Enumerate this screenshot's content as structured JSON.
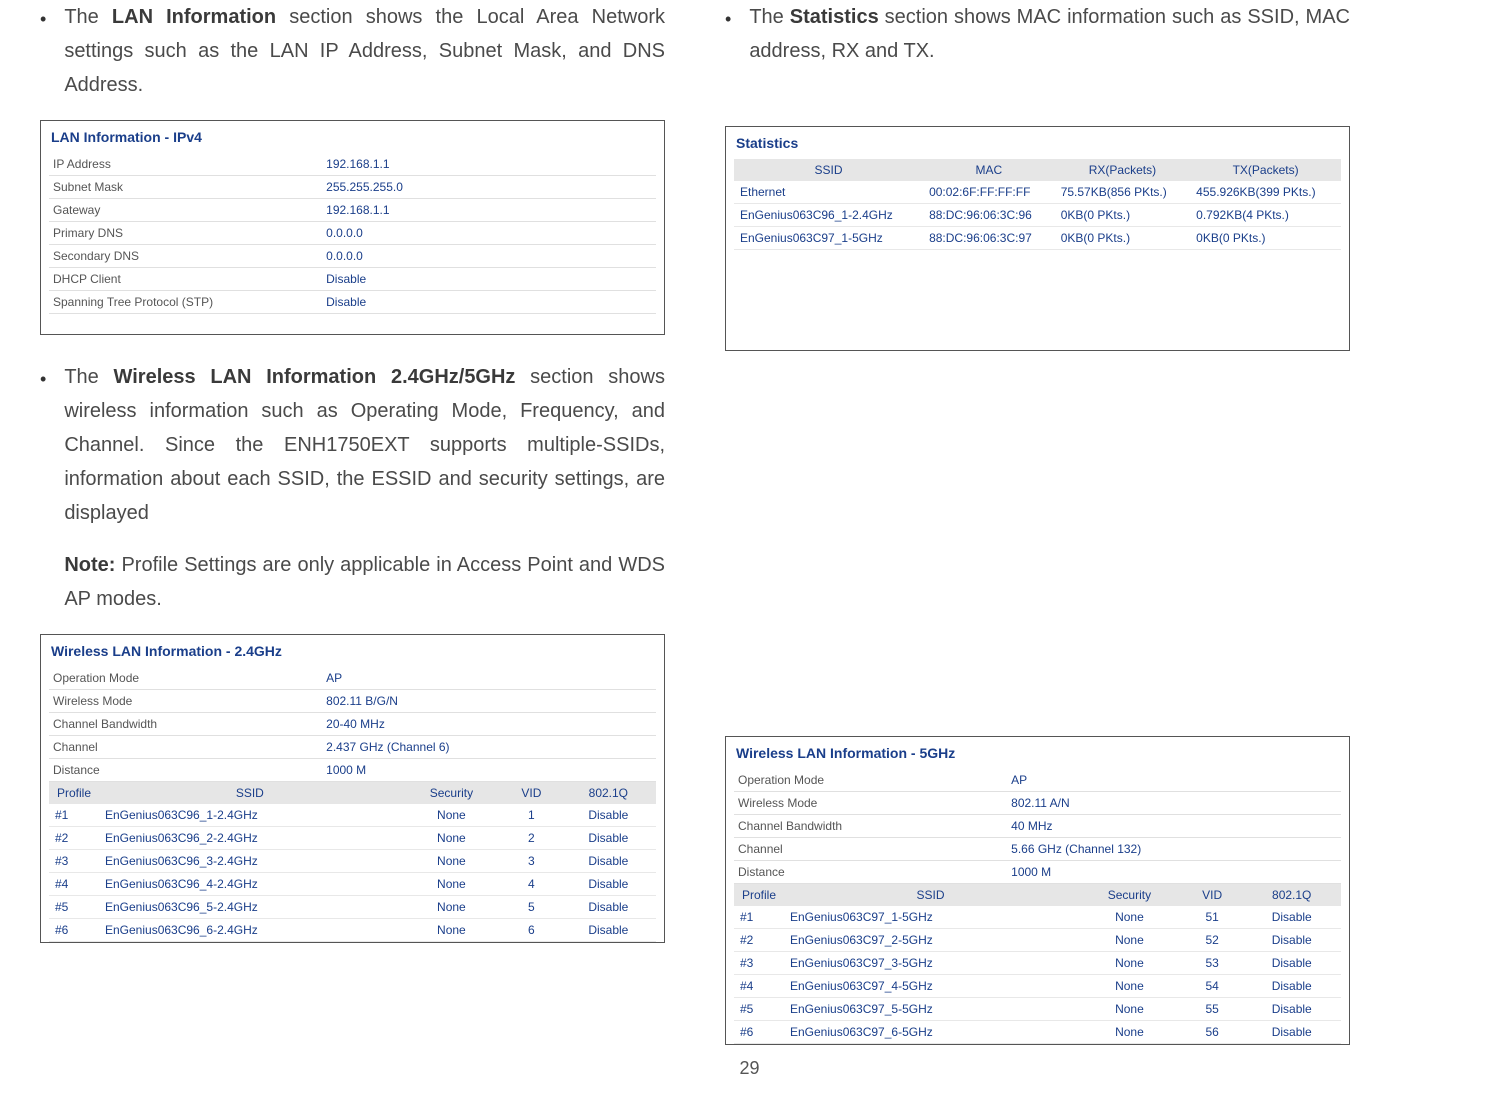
{
  "pageNumber": "29",
  "left": {
    "para1_a": "The ",
    "para1_b": "LAN Information",
    "para1_c": " section shows the Local Area Network settings such as the LAN IP Address, Subnet Mask, and DNS Address.",
    "lanTitle": "LAN Information - IPv4",
    "lan": [
      {
        "k": "IP Address",
        "v": "192.168.1.1"
      },
      {
        "k": "Subnet Mask",
        "v": "255.255.255.0"
      },
      {
        "k": "Gateway",
        "v": "192.168.1.1"
      },
      {
        "k": "Primary DNS",
        "v": "0.0.0.0"
      },
      {
        "k": "Secondary DNS",
        "v": "0.0.0.0"
      },
      {
        "k": "DHCP Client",
        "v": "Disable"
      },
      {
        "k": "Spanning Tree Protocol (STP)",
        "v": "Disable"
      }
    ],
    "para2_a": "The ",
    "para2_b": "Wireless LAN Information 2.4GHz/5GHz",
    "para2_c": " section shows wireless information such as Operating Mode, Frequency, and Channel. Since the ENH1750EXT supports multiple-SSIDs, information about each SSID, the ESSID and security settings, are displayed",
    "note_a": "Note:",
    "note_b": " Profile Settings are only applicable in Access Point and WDS AP modes.",
    "wlan24Title": "Wireless LAN Information - 2.4GHz",
    "wlan24Kv": [
      {
        "k": "Operation Mode",
        "v": "AP"
      },
      {
        "k": "Wireless Mode",
        "v": "802.11 B/G/N"
      },
      {
        "k": "Channel Bandwidth",
        "v": "20-40 MHz"
      },
      {
        "k": "Channel",
        "v": "2.437 GHz (Channel 6)"
      },
      {
        "k": "Distance",
        "v": "1000 M"
      }
    ],
    "profHeaders": {
      "p": "Profile",
      "s": "SSID",
      "sec": "Security",
      "vid": "VID",
      "q": "802.1Q"
    },
    "prof24": [
      {
        "p": "#1",
        "s": "EnGenius063C96_1-2.4GHz",
        "sec": "None",
        "vid": "1",
        "q": "Disable"
      },
      {
        "p": "#2",
        "s": "EnGenius063C96_2-2.4GHz",
        "sec": "None",
        "vid": "2",
        "q": "Disable"
      },
      {
        "p": "#3",
        "s": "EnGenius063C96_3-2.4GHz",
        "sec": "None",
        "vid": "3",
        "q": "Disable"
      },
      {
        "p": "#4",
        "s": "EnGenius063C96_4-2.4GHz",
        "sec": "None",
        "vid": "4",
        "q": "Disable"
      },
      {
        "p": "#5",
        "s": "EnGenius063C96_5-2.4GHz",
        "sec": "None",
        "vid": "5",
        "q": "Disable"
      },
      {
        "p": "#6",
        "s": "EnGenius063C96_6-2.4GHz",
        "sec": "None",
        "vid": "6",
        "q": "Disable"
      }
    ]
  },
  "right": {
    "para1_a": "The ",
    "para1_b": "Statistics",
    "para1_c": " section shows MAC information such as SSID, MAC address, RX and TX.",
    "statsTitle": "Statistics",
    "statsHeaders": {
      "s": "SSID",
      "m": "MAC",
      "r": "RX(Packets)",
      "t": "TX(Packets)"
    },
    "stats": [
      {
        "s": "Ethernet",
        "m": "00:02:6F:FF:FF:FF",
        "r": "75.57KB(856 PKts.)",
        "t": "455.926KB(399 PKts.)"
      },
      {
        "s": "EnGenius063C96_1-2.4GHz",
        "m": "88:DC:96:06:3C:96",
        "r": "0KB(0 PKts.)",
        "t": "0.792KB(4 PKts.)"
      },
      {
        "s": "EnGenius063C97_1-5GHz",
        "m": "88:DC:96:06:3C:97",
        "r": "0KB(0 PKts.)",
        "t": "0KB(0 PKts.)"
      }
    ],
    "wlan5Title": "Wireless LAN Information - 5GHz",
    "wlan5Kv": [
      {
        "k": "Operation Mode",
        "v": "AP"
      },
      {
        "k": "Wireless Mode",
        "v": "802.11 A/N"
      },
      {
        "k": "Channel Bandwidth",
        "v": "40 MHz"
      },
      {
        "k": "Channel",
        "v": "5.66 GHz (Channel 132)"
      },
      {
        "k": "Distance",
        "v": "1000 M"
      }
    ],
    "prof5": [
      {
        "p": "#1",
        "s": "EnGenius063C97_1-5GHz",
        "sec": "None",
        "vid": "51",
        "q": "Disable"
      },
      {
        "p": "#2",
        "s": "EnGenius063C97_2-5GHz",
        "sec": "None",
        "vid": "52",
        "q": "Disable"
      },
      {
        "p": "#3",
        "s": "EnGenius063C97_3-5GHz",
        "sec": "None",
        "vid": "53",
        "q": "Disable"
      },
      {
        "p": "#4",
        "s": "EnGenius063C97_4-5GHz",
        "sec": "None",
        "vid": "54",
        "q": "Disable"
      },
      {
        "p": "#5",
        "s": "EnGenius063C97_5-5GHz",
        "sec": "None",
        "vid": "55",
        "q": "Disable"
      },
      {
        "p": "#6",
        "s": "EnGenius063C97_6-5GHz",
        "sec": "None",
        "vid": "56",
        "q": "Disable"
      }
    ]
  }
}
